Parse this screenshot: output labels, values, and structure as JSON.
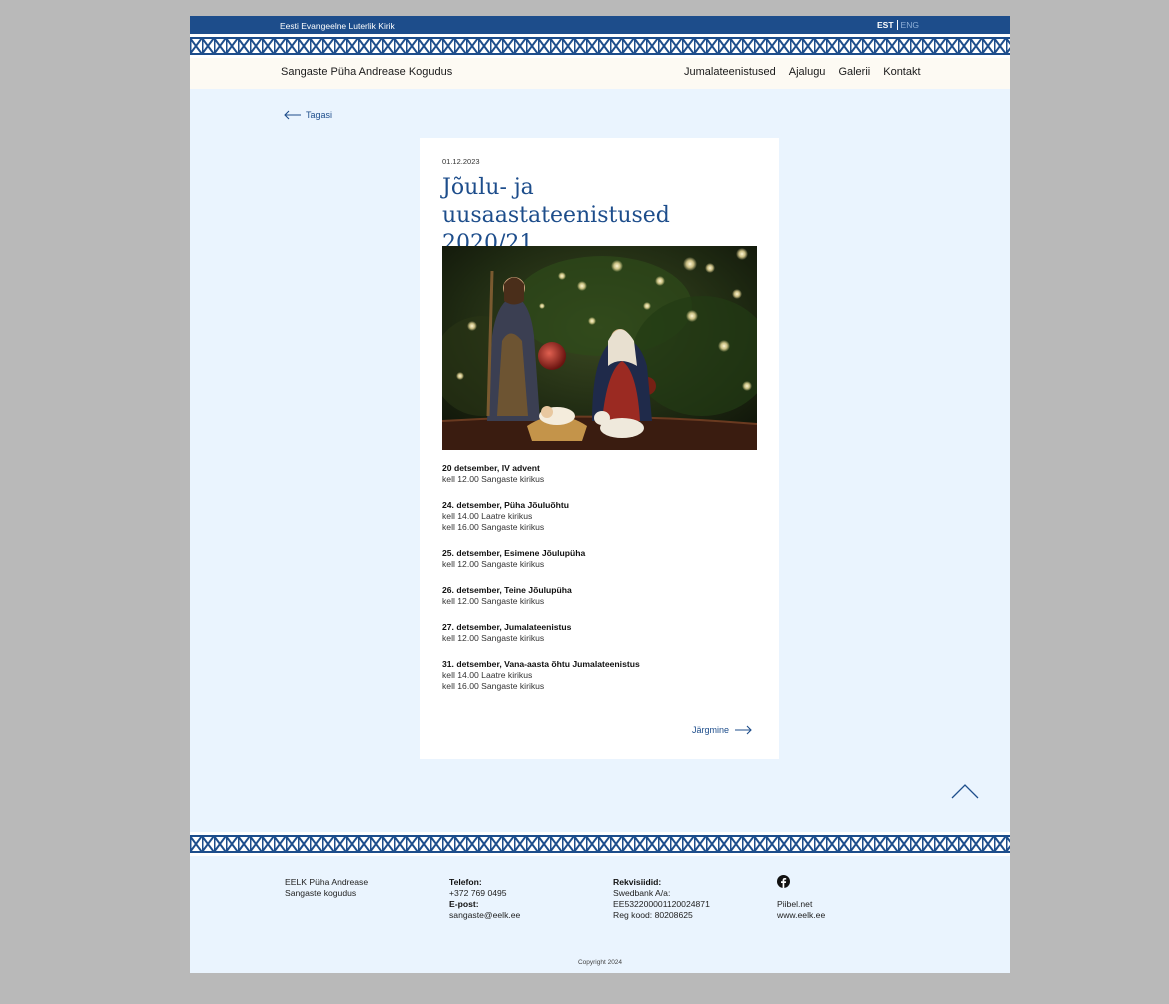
{
  "topbar": {
    "church_name": "Eesti Evangeelne Luterlik Kirik",
    "lang_active": "EST",
    "lang_inactive": "ENG"
  },
  "nav": {
    "site_name": "Sangaste Püha Andrease Kogudus",
    "items": [
      "Jumalateenistused",
      "Ajalugu",
      "Galerii",
      "Kontakt"
    ]
  },
  "back_label": "Tagasi",
  "article": {
    "date": "01.12.2023",
    "title": "Jõulu- ja uusaastateenistused 2020/21",
    "events": [
      {
        "title": "20 detsember, IV advent",
        "lines": [
          "kell 12.00 Sangaste kirikus"
        ]
      },
      {
        "title": "24. detsember, Püha Jõuluõhtu",
        "lines": [
          "kell 14.00 Laatre kirikus",
          "kell 16.00 Sangaste kirikus"
        ]
      },
      {
        "title": "25. detsember, Esimene Jõulupüha",
        "lines": [
          "kell 12.00 Sangaste kirikus"
        ]
      },
      {
        "title": "26. detsember, Teine Jõulupüha",
        "lines": [
          "kell 12.00 Sangaste kirikus"
        ]
      },
      {
        "title": "27. detsember, Jumalateenistus",
        "lines": [
          "kell 12.00 Sangaste kirikus"
        ]
      },
      {
        "title": "31. detsember, Vana-aasta õhtu Jumalateenistus",
        "lines": [
          "kell 14.00 Laatre kirikus",
          "kell 16.00 Sangaste kirikus"
        ]
      }
    ],
    "next_label": "Järgmine"
  },
  "footer": {
    "org_line1": "EELK Püha Andrease",
    "org_line2": "Sangaste kogudus",
    "phone_label": "Telefon:",
    "phone": "+372 769 0495",
    "email_label": "E-post:",
    "email": "sangaste@eelk.ee",
    "bank_label": "Rekvisiidid:",
    "bank_name": "Swedbank A/a:",
    "iban": "EE532200001120024871",
    "reg_code": "Reg kood: 80208625",
    "link1": "Piibel.net",
    "link2": "www.eelk.ee",
    "copyright": "Copyright 2024"
  },
  "colors": {
    "brand_blue": "#1d4d8b",
    "page_bg": "#eaf4fe",
    "nav_bg": "#fdfaf3"
  },
  "icons": {
    "back": "arrow-left-icon",
    "next": "arrow-right-icon",
    "scroll_top": "chevron-up-icon",
    "social": "facebook-icon"
  }
}
